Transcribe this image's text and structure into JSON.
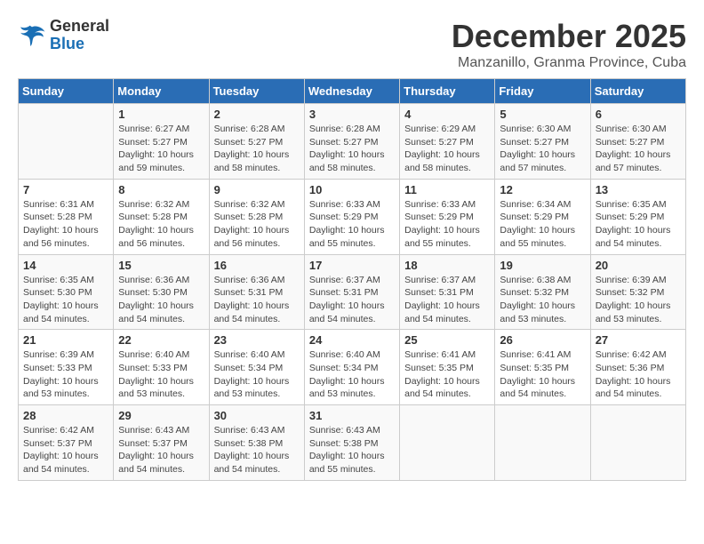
{
  "header": {
    "logo_line1": "General",
    "logo_line2": "Blue",
    "title": "December 2025",
    "subtitle": "Manzanillo, Granma Province, Cuba"
  },
  "columns": [
    "Sunday",
    "Monday",
    "Tuesday",
    "Wednesday",
    "Thursday",
    "Friday",
    "Saturday"
  ],
  "weeks": [
    [
      {
        "day": "",
        "info": ""
      },
      {
        "day": "1",
        "info": "Sunrise: 6:27 AM\nSunset: 5:27 PM\nDaylight: 10 hours\nand 59 minutes."
      },
      {
        "day": "2",
        "info": "Sunrise: 6:28 AM\nSunset: 5:27 PM\nDaylight: 10 hours\nand 58 minutes."
      },
      {
        "day": "3",
        "info": "Sunrise: 6:28 AM\nSunset: 5:27 PM\nDaylight: 10 hours\nand 58 minutes."
      },
      {
        "day": "4",
        "info": "Sunrise: 6:29 AM\nSunset: 5:27 PM\nDaylight: 10 hours\nand 58 minutes."
      },
      {
        "day": "5",
        "info": "Sunrise: 6:30 AM\nSunset: 5:27 PM\nDaylight: 10 hours\nand 57 minutes."
      },
      {
        "day": "6",
        "info": "Sunrise: 6:30 AM\nSunset: 5:27 PM\nDaylight: 10 hours\nand 57 minutes."
      }
    ],
    [
      {
        "day": "7",
        "info": "Sunrise: 6:31 AM\nSunset: 5:28 PM\nDaylight: 10 hours\nand 56 minutes."
      },
      {
        "day": "8",
        "info": "Sunrise: 6:32 AM\nSunset: 5:28 PM\nDaylight: 10 hours\nand 56 minutes."
      },
      {
        "day": "9",
        "info": "Sunrise: 6:32 AM\nSunset: 5:28 PM\nDaylight: 10 hours\nand 56 minutes."
      },
      {
        "day": "10",
        "info": "Sunrise: 6:33 AM\nSunset: 5:29 PM\nDaylight: 10 hours\nand 55 minutes."
      },
      {
        "day": "11",
        "info": "Sunrise: 6:33 AM\nSunset: 5:29 PM\nDaylight: 10 hours\nand 55 minutes."
      },
      {
        "day": "12",
        "info": "Sunrise: 6:34 AM\nSunset: 5:29 PM\nDaylight: 10 hours\nand 55 minutes."
      },
      {
        "day": "13",
        "info": "Sunrise: 6:35 AM\nSunset: 5:29 PM\nDaylight: 10 hours\nand 54 minutes."
      }
    ],
    [
      {
        "day": "14",
        "info": "Sunrise: 6:35 AM\nSunset: 5:30 PM\nDaylight: 10 hours\nand 54 minutes."
      },
      {
        "day": "15",
        "info": "Sunrise: 6:36 AM\nSunset: 5:30 PM\nDaylight: 10 hours\nand 54 minutes."
      },
      {
        "day": "16",
        "info": "Sunrise: 6:36 AM\nSunset: 5:31 PM\nDaylight: 10 hours\nand 54 minutes."
      },
      {
        "day": "17",
        "info": "Sunrise: 6:37 AM\nSunset: 5:31 PM\nDaylight: 10 hours\nand 54 minutes."
      },
      {
        "day": "18",
        "info": "Sunrise: 6:37 AM\nSunset: 5:31 PM\nDaylight: 10 hours\nand 54 minutes."
      },
      {
        "day": "19",
        "info": "Sunrise: 6:38 AM\nSunset: 5:32 PM\nDaylight: 10 hours\nand 53 minutes."
      },
      {
        "day": "20",
        "info": "Sunrise: 6:39 AM\nSunset: 5:32 PM\nDaylight: 10 hours\nand 53 minutes."
      }
    ],
    [
      {
        "day": "21",
        "info": "Sunrise: 6:39 AM\nSunset: 5:33 PM\nDaylight: 10 hours\nand 53 minutes."
      },
      {
        "day": "22",
        "info": "Sunrise: 6:40 AM\nSunset: 5:33 PM\nDaylight: 10 hours\nand 53 minutes."
      },
      {
        "day": "23",
        "info": "Sunrise: 6:40 AM\nSunset: 5:34 PM\nDaylight: 10 hours\nand 53 minutes."
      },
      {
        "day": "24",
        "info": "Sunrise: 6:40 AM\nSunset: 5:34 PM\nDaylight: 10 hours\nand 53 minutes."
      },
      {
        "day": "25",
        "info": "Sunrise: 6:41 AM\nSunset: 5:35 PM\nDaylight: 10 hours\nand 54 minutes."
      },
      {
        "day": "26",
        "info": "Sunrise: 6:41 AM\nSunset: 5:35 PM\nDaylight: 10 hours\nand 54 minutes."
      },
      {
        "day": "27",
        "info": "Sunrise: 6:42 AM\nSunset: 5:36 PM\nDaylight: 10 hours\nand 54 minutes."
      }
    ],
    [
      {
        "day": "28",
        "info": "Sunrise: 6:42 AM\nSunset: 5:37 PM\nDaylight: 10 hours\nand 54 minutes."
      },
      {
        "day": "29",
        "info": "Sunrise: 6:43 AM\nSunset: 5:37 PM\nDaylight: 10 hours\nand 54 minutes."
      },
      {
        "day": "30",
        "info": "Sunrise: 6:43 AM\nSunset: 5:38 PM\nDaylight: 10 hours\nand 54 minutes."
      },
      {
        "day": "31",
        "info": "Sunrise: 6:43 AM\nSunset: 5:38 PM\nDaylight: 10 hours\nand 55 minutes."
      },
      {
        "day": "",
        "info": ""
      },
      {
        "day": "",
        "info": ""
      },
      {
        "day": "",
        "info": ""
      }
    ]
  ]
}
